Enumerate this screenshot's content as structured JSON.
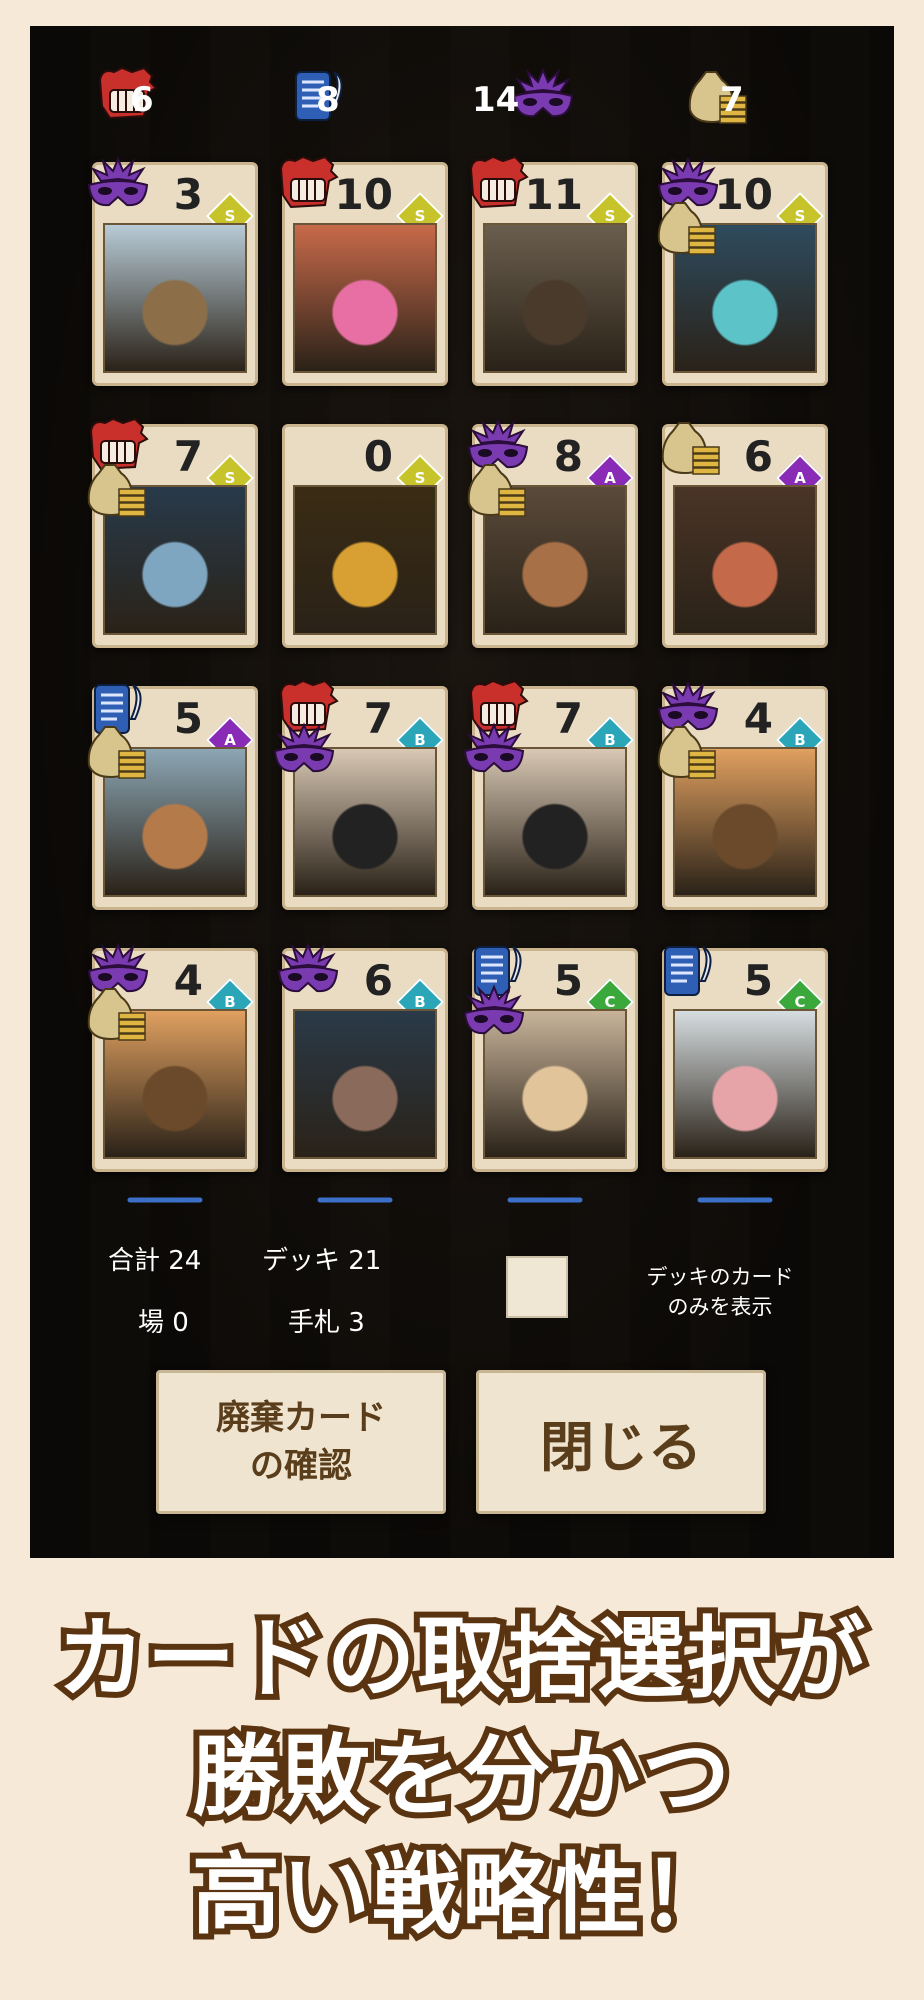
{
  "stats": [
    {
      "icon": "fist-icon",
      "value": "6",
      "color": "#c9302c"
    },
    {
      "icon": "scroll-icon",
      "value": "8",
      "color": "#2f5fb4"
    },
    {
      "icon": "mask-icon",
      "value": "14",
      "color": "#7a3ab0"
    },
    {
      "icon": "money-bag-icon",
      "value": "7",
      "color": "#d8c58e"
    }
  ],
  "cards": [
    {
      "value": "3",
      "gem": "S",
      "gem_color": "#c7c32a",
      "badges": [
        "mask-icon"
      ],
      "art": "llama-icon"
    },
    {
      "value": "10",
      "gem": "S",
      "gem_color": "#c7c32a",
      "badges": [
        "fist-icon"
      ],
      "art": "clown-lady-icon"
    },
    {
      "value": "11",
      "gem": "S",
      "gem_color": "#c7c32a",
      "badges": [
        "fist-icon"
      ],
      "art": "gorilla-icon"
    },
    {
      "value": "10",
      "gem": "S",
      "gem_color": "#c7c32a",
      "badges": [
        "mask-icon",
        "money-bag-icon"
      ],
      "art": "cinderella-icon"
    },
    {
      "value": "7",
      "gem": "S",
      "gem_color": "#c7c32a",
      "badges": [
        "fist-icon",
        "money-bag-icon"
      ],
      "art": "penguin-icon"
    },
    {
      "value": "0",
      "gem": "S",
      "gem_color": "#c7c32a",
      "badges": [],
      "art": "treasure-chest-icon"
    },
    {
      "value": "8",
      "gem": "A",
      "gem_color": "#8a2bb8",
      "badges": [
        "mask-icon",
        "money-bag-icon"
      ],
      "art": "monkey-icon"
    },
    {
      "value": "6",
      "gem": "A",
      "gem_color": "#8a2bb8",
      "badges": [
        "money-bag-icon"
      ],
      "art": "fox-lady-icon"
    },
    {
      "value": "5",
      "gem": "A",
      "gem_color": "#8a2bb8",
      "badges": [
        "scroll-icon",
        "money-bag-icon"
      ],
      "art": "kangaroo-icon"
    },
    {
      "value": "7",
      "gem": "B",
      "gem_color": "#2aa6b8",
      "badges": [
        "fist-icon",
        "mask-icon"
      ],
      "art": "black-cat-icon"
    },
    {
      "value": "7",
      "gem": "B",
      "gem_color": "#2aa6b8",
      "badges": [
        "fist-icon",
        "mask-icon"
      ],
      "art": "black-cat-icon"
    },
    {
      "value": "4",
      "gem": "B",
      "gem_color": "#2aa6b8",
      "badges": [
        "mask-icon",
        "money-bag-icon"
      ],
      "art": "cow-icon"
    },
    {
      "value": "4",
      "gem": "B",
      "gem_color": "#2aa6b8",
      "badges": [
        "mask-icon",
        "money-bag-icon"
      ],
      "art": "cow-icon"
    },
    {
      "value": "6",
      "gem": "B",
      "gem_color": "#2aa6b8",
      "badges": [
        "mask-icon"
      ],
      "art": "ferret-icon"
    },
    {
      "value": "5",
      "gem": "C",
      "gem_color": "#3aa83a",
      "badges": [
        "scroll-icon",
        "mask-icon"
      ],
      "art": "fennec-icon"
    },
    {
      "value": "5",
      "gem": "C",
      "gem_color": "#3aa83a",
      "badges": [
        "scroll-icon"
      ],
      "art": "pig-scientist-icon"
    }
  ],
  "info": {
    "total_label": "合計 24",
    "deck_label": "デッキ 21",
    "field_label": "場 0",
    "hand_label": "手札 3",
    "deck_only_label_1": "デッキのカード",
    "deck_only_label_2": "のみを表示"
  },
  "buttons": {
    "discard_line1": "廃棄カード",
    "discard_line2": "の確認",
    "close": "閉じる"
  },
  "caption": {
    "line1": "カードの取捨選択が",
    "line2": "勝敗を分かつ",
    "line3": "高い戦略性！"
  }
}
